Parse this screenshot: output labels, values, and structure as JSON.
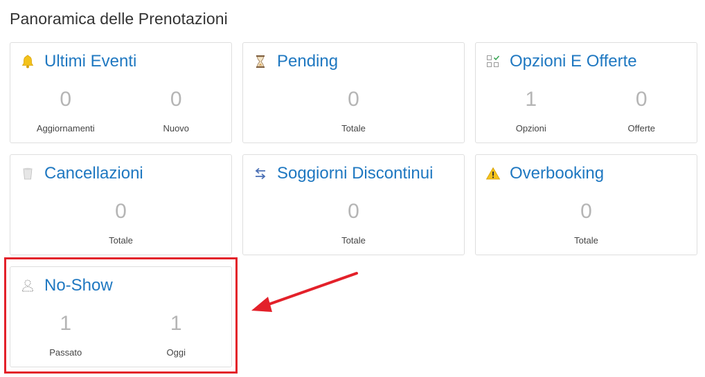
{
  "header": {
    "title": "Panoramica delle Prenotazioni"
  },
  "cards": [
    {
      "title": "Ultimi Eventi",
      "icon": "bell-icon",
      "stats": [
        {
          "value": "0",
          "label": "Aggiornamenti"
        },
        {
          "value": "0",
          "label": "Nuovo"
        }
      ]
    },
    {
      "title": "Pending",
      "icon": "hourglass-icon",
      "stats": [
        {
          "value": "0",
          "label": "Totale"
        }
      ]
    },
    {
      "title": "Opzioni E Offerte",
      "icon": "checklist-icon",
      "stats": [
        {
          "value": "1",
          "label": "Opzioni"
        },
        {
          "value": "0",
          "label": "Offerte"
        }
      ]
    },
    {
      "title": "Cancellazioni",
      "icon": "trash-icon",
      "stats": [
        {
          "value": "0",
          "label": "Totale"
        }
      ]
    },
    {
      "title": "Soggiorni Discontinui",
      "icon": "swap-arrows-icon",
      "stats": [
        {
          "value": "0",
          "label": "Totale"
        }
      ]
    },
    {
      "title": "Overbooking",
      "icon": "warning-icon",
      "stats": [
        {
          "value": "0",
          "label": "Totale"
        }
      ]
    },
    {
      "title": "No-Show",
      "icon": "person-outline-icon",
      "stats": [
        {
          "value": "1",
          "label": "Passato"
        },
        {
          "value": "1",
          "label": "Oggi"
        }
      ]
    }
  ],
  "colors": {
    "title_blue": "#1f78c1",
    "annotation_red": "#e3212a",
    "value_gray": "#b5b5b5"
  }
}
